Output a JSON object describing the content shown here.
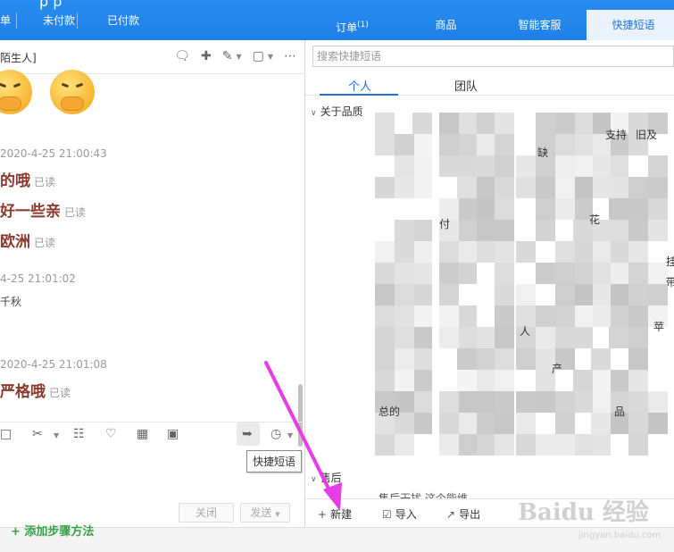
{
  "topbar": {
    "ghost_text": "p    p",
    "left_tabs": [
      "单",
      "未付款",
      "已付款"
    ],
    "right_tabs": [
      {
        "label": "订单",
        "sup": "(1)"
      },
      {
        "label": "商品"
      },
      {
        "label": "智能客服"
      },
      {
        "label": "快捷短语"
      }
    ]
  },
  "chat": {
    "title": "陌生人]",
    "messages": [
      {
        "time": "2020-4-25 21:00:43"
      },
      {
        "text": "的哦",
        "read": "已读"
      },
      {
        "text": "好一些亲",
        "read": "已读"
      },
      {
        "text": "欧洲",
        "read": "已读"
      },
      {
        "time": "4-25 21:01:02"
      },
      {
        "plain": "千秋"
      },
      {
        "time": "2020-4-25 21:01:08"
      },
      {
        "text": "严格哦",
        "read": "已读"
      }
    ],
    "tooltip": "快捷短语",
    "close_label": "关闭",
    "send_label": "发送"
  },
  "quick": {
    "search_placeholder": "搜索快捷短语",
    "tabs": [
      "个人",
      "团队"
    ],
    "section1": "关于品质",
    "section2": "售后",
    "fragments": [
      "支持",
      "旧及",
      "花",
      "缺",
      "挂",
      "带",
      "苹",
      "总的",
      "人",
      "产",
      "品",
      "付",
      "售后干扰",
      "这个能维"
    ],
    "footer": {
      "new": "新建",
      "import": "导入",
      "export": "导出"
    }
  },
  "page": {
    "add_step": "+ 添加步骤方法",
    "watermark": "Baidu 经验",
    "watermark_sub": "jingyan.baidu.com"
  }
}
